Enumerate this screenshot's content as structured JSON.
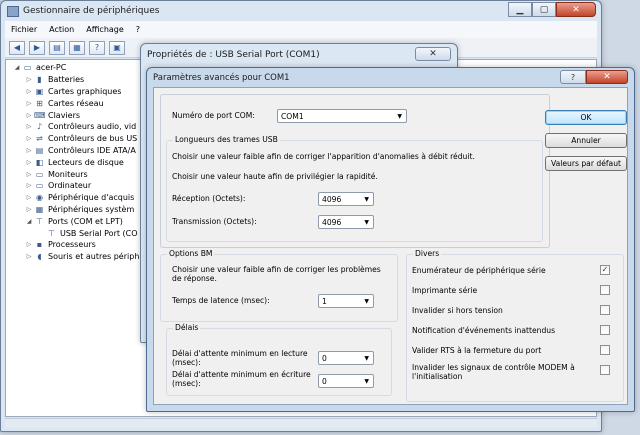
{
  "device_manager": {
    "title": "Gestionnaire de périphériques",
    "menu": [
      "Fichier",
      "Action",
      "Affichage",
      "?"
    ],
    "tree": [
      {
        "label": "acer-PC",
        "level": 0,
        "toggle": "◢",
        "icon": "computer-icon"
      },
      {
        "label": "Batteries",
        "level": 1,
        "toggle": "▷",
        "icon": "battery-icon"
      },
      {
        "label": "Cartes graphiques",
        "level": 1,
        "toggle": "▷",
        "icon": "display-adapter-icon"
      },
      {
        "label": "Cartes réseau",
        "level": 1,
        "toggle": "▷",
        "icon": "network-adapter-icon"
      },
      {
        "label": "Claviers",
        "level": 1,
        "toggle": "▷",
        "icon": "keyboard-icon"
      },
      {
        "label": "Contrôleurs audio, vid",
        "level": 1,
        "toggle": "▷",
        "icon": "audio-icon"
      },
      {
        "label": "Contrôleurs de bus US",
        "level": 1,
        "toggle": "▷",
        "icon": "usb-icon"
      },
      {
        "label": "Contrôleurs IDE ATA/A",
        "level": 1,
        "toggle": "▷",
        "icon": "ide-icon"
      },
      {
        "label": "Lecteurs de disque",
        "level": 1,
        "toggle": "▷",
        "icon": "disk-icon"
      },
      {
        "label": "Moniteurs",
        "level": 1,
        "toggle": "▷",
        "icon": "monitor-icon"
      },
      {
        "label": "Ordinateur",
        "level": 1,
        "toggle": "▷",
        "icon": "computer-icon"
      },
      {
        "label": "Périphérique d'acquis",
        "level": 1,
        "toggle": "▷",
        "icon": "camera-icon"
      },
      {
        "label": "Périphériques systèm",
        "level": 1,
        "toggle": "▷",
        "icon": "system-icon"
      },
      {
        "label": "Ports (COM et LPT)",
        "level": 1,
        "toggle": "◢",
        "icon": "port-icon"
      },
      {
        "label": "USB Serial Port (CO",
        "level": 2,
        "toggle": "",
        "icon": "port-icon"
      },
      {
        "label": "Processeurs",
        "level": 1,
        "toggle": "▷",
        "icon": "processor-icon"
      },
      {
        "label": "Souris et autres périph",
        "level": 1,
        "toggle": "▷",
        "icon": "mouse-icon"
      }
    ]
  },
  "properties": {
    "title": "Propriétés de : USB Serial Port (COM1)",
    "close_label": "✕"
  },
  "advanced": {
    "title": "Paramètres avancés pour COM1",
    "help_label": "?",
    "close_label": "✕",
    "com_port_label": "Numéro de port COM:",
    "com_port_value": "COM1",
    "usb_group_title": "Longueurs des trames USB",
    "usb_hint_low": "Choisir une valeur faible afin de corriger  l'apparition d'anomalies à débit réduit.",
    "usb_hint_high": "Choisir une valeur haute afin de privilégier la rapidité.",
    "receive_label": "Réception (Octets):",
    "receive_value": "4096",
    "transmit_label": "Transmission (Octets):",
    "transmit_value": "4096",
    "bm_group_title": "Options BM",
    "bm_hint": "Choisir une valeur faible afin de corriger les problèmes de réponse.",
    "latency_label": "Temps de latence (msec):",
    "latency_value": "1",
    "timeouts_group_title": "Délais",
    "read_timeout_label": "Délai d'attente minimum en lecture (msec):",
    "read_timeout_value": "0",
    "write_timeout_label": "Délai d'attente minimum en écriture (msec):",
    "write_timeout_value": "0",
    "misc_group_title": "Divers",
    "options": [
      {
        "label": "Enumérateur de périphérique série",
        "checked": true
      },
      {
        "label": "Imprimante série",
        "checked": false
      },
      {
        "label": "Invalider si hors tension",
        "checked": false
      },
      {
        "label": "Notification d'événements inattendus",
        "checked": false
      },
      {
        "label": "Valider RTS à la fermeture du port",
        "checked": false
      },
      {
        "label": "Invalider les signaux de contrôle MODEM à l'initialisation",
        "checked": false
      }
    ],
    "ok_label": "OK",
    "cancel_label": "Annuler",
    "defaults_label": "Valeurs par défaut"
  }
}
